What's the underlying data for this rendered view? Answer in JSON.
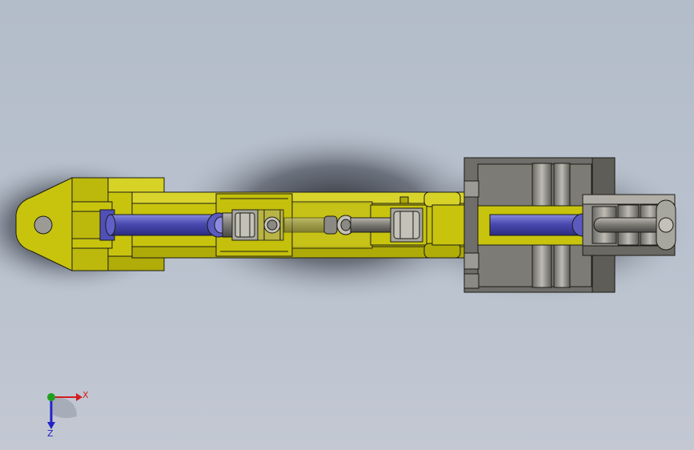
{
  "colors": {
    "background_top": "#b3bcc9",
    "background_bottom": "#c3c8d3",
    "yellow": "#c8c40e",
    "yellow_light": "#dcd832",
    "yellow_dark": "#9a9606",
    "blue_rod": "#4a4ab0",
    "blue_rod_light": "#7474d8",
    "gray_body": "#6f6e6a",
    "gray_light": "#9b9a94",
    "gray_dark": "#4a4946",
    "outline": "#1c1c14",
    "x_axis": "#d21e1e",
    "y_axis": "#1ea01e",
    "z_axis": "#2222c8"
  },
  "triad": {
    "x_label": "X",
    "z_label": "Z",
    "x_icon": "x-axis-arrow-icon",
    "y_icon": "y-axis-dot-icon",
    "z_icon": "z-axis-arrow-icon"
  }
}
